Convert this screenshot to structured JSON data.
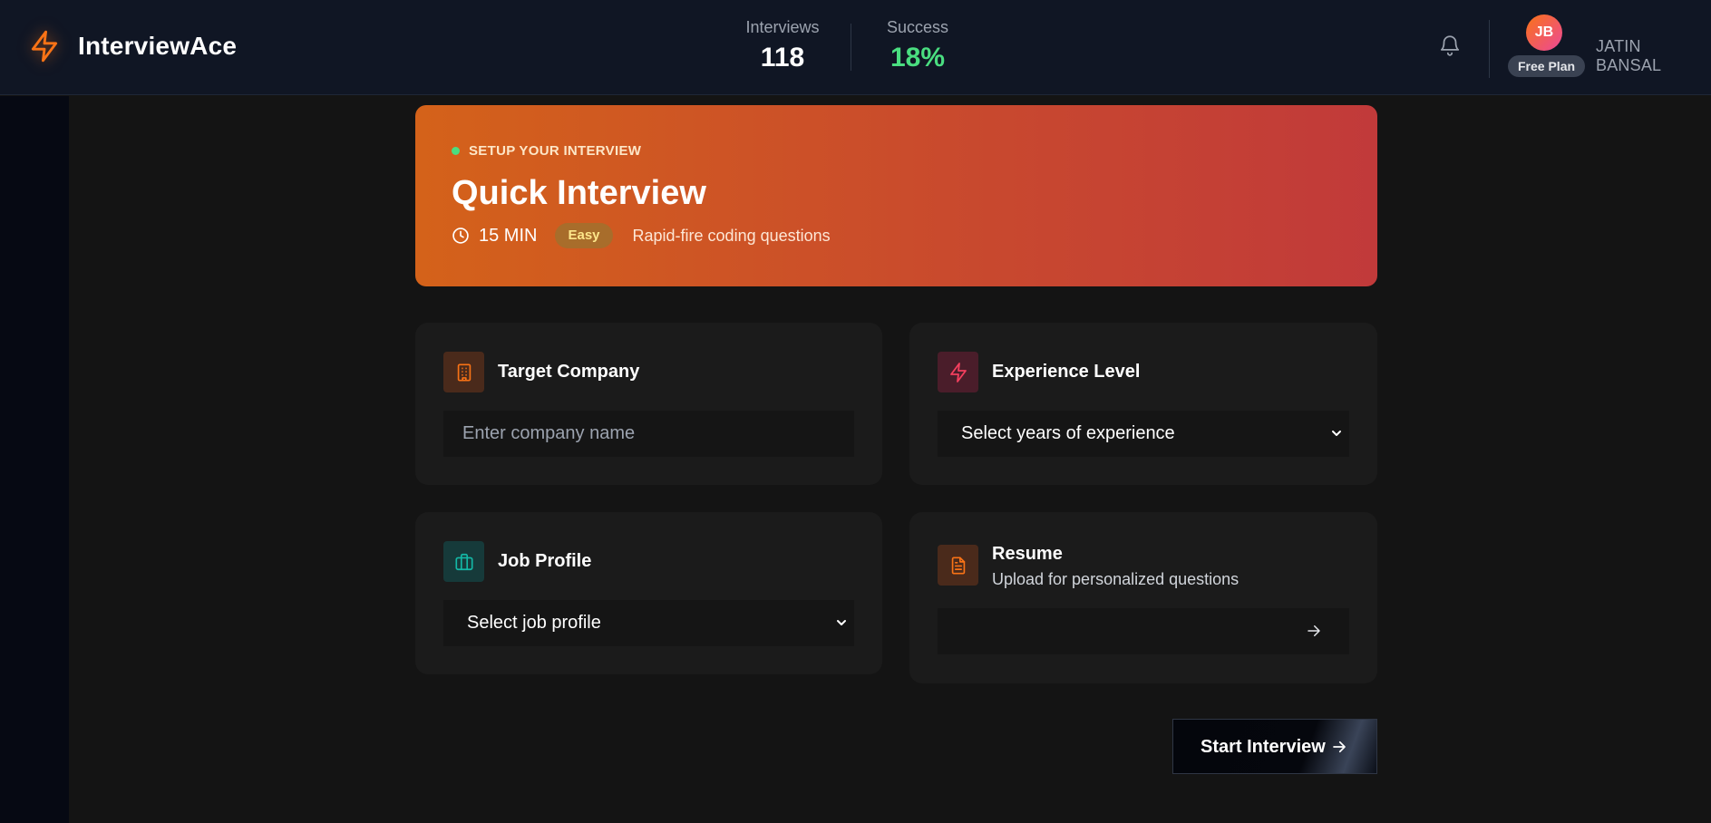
{
  "header": {
    "app_name": "InterviewAce",
    "stats": {
      "interviews_label": "Interviews",
      "interviews_value": "118",
      "success_label": "Success",
      "success_value": "18%"
    },
    "user": {
      "initials": "JB",
      "plan": "Free Plan",
      "name": "JATIN BANSAL"
    }
  },
  "hero": {
    "tag": "SETUP YOUR INTERVIEW",
    "title": "Quick Interview",
    "duration": "15 MIN",
    "difficulty": "Easy",
    "description": "Rapid-fire coding questions"
  },
  "form": {
    "company": {
      "label": "Target Company",
      "placeholder": "Enter company name",
      "icon": "building-icon"
    },
    "experience": {
      "label": "Experience Level",
      "selected": "Select years of experience",
      "icon": "lightning-icon"
    },
    "job_profile": {
      "label": "Job Profile",
      "selected": "Select job profile",
      "icon": "briefcase-icon"
    },
    "resume": {
      "label": "Resume",
      "sublabel": "Upload for personalized questions",
      "icon": "document-icon"
    }
  },
  "actions": {
    "start_label": "Start Interview"
  },
  "colors": {
    "accent_orange": "#f97316",
    "success_green": "#4ade80",
    "hero_start": "#d4621a",
    "hero_end": "#c13a3a"
  }
}
